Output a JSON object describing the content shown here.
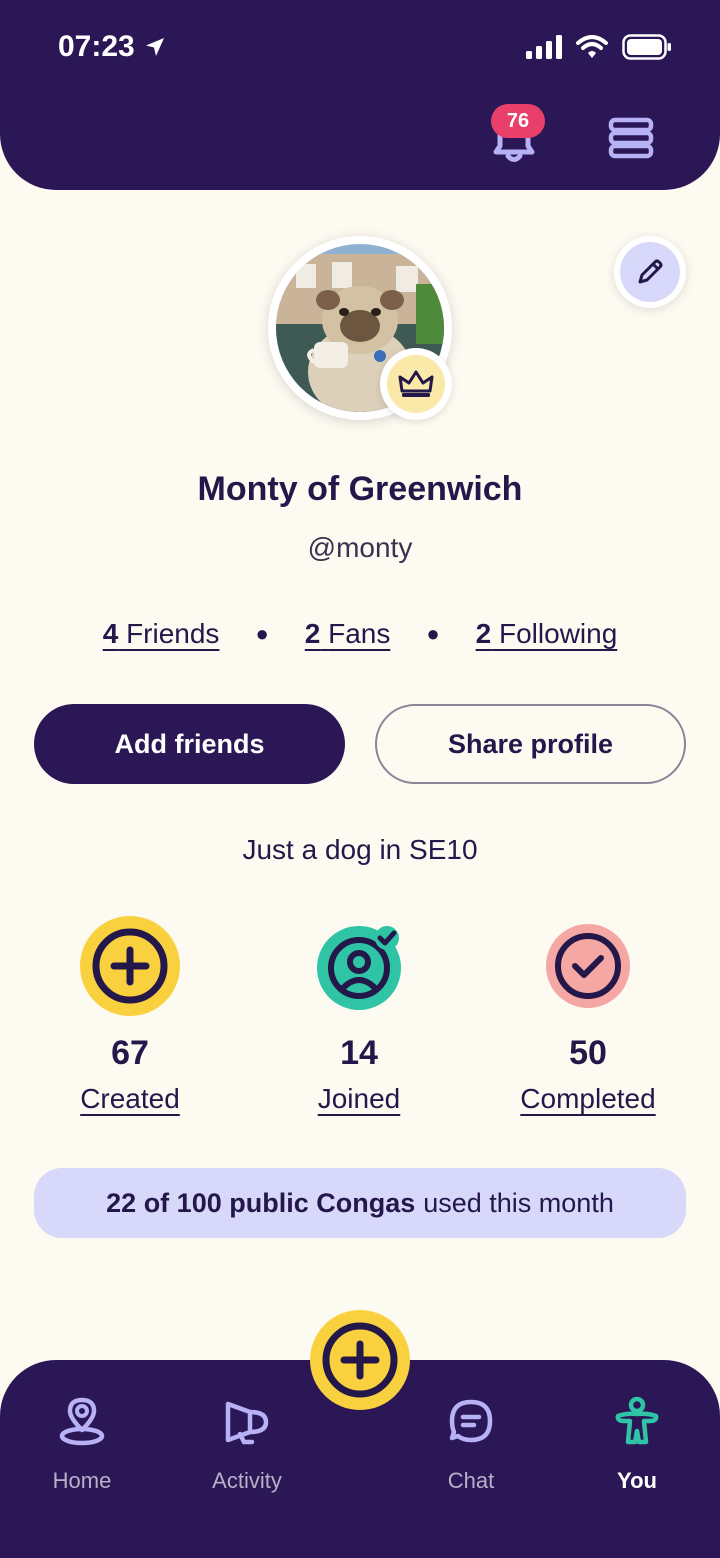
{
  "status_bar": {
    "time": "07:23"
  },
  "header": {
    "notification_count": "76"
  },
  "profile": {
    "name": "Monty of Greenwich",
    "handle": "@monty",
    "social": [
      {
        "count": "4",
        "label": "Friends"
      },
      {
        "count": "2",
        "label": "Fans"
      },
      {
        "count": "2",
        "label": "Following"
      }
    ],
    "bio": "Just a dog in SE10"
  },
  "actions": {
    "add_friends": "Add friends",
    "share_profile": "Share profile"
  },
  "stats": [
    {
      "value": "67",
      "label": "Created",
      "icon": "plus-circle-icon",
      "color": "#f9d13e"
    },
    {
      "value": "14",
      "label": "Joined",
      "icon": "user-check-icon",
      "color": "#2ec4a5"
    },
    {
      "value": "50",
      "label": "Completed",
      "icon": "check-circle-icon",
      "color": "#f4a7a3"
    }
  ],
  "quota": {
    "bold": "22 of 100 public Congas",
    "rest": "used this month"
  },
  "tabs": [
    {
      "label": "Home",
      "icon": "map-pin-icon"
    },
    {
      "label": "Activity",
      "icon": "megaphone-icon"
    },
    {
      "label": "Chat",
      "icon": "chat-bubble-icon"
    },
    {
      "label": "You",
      "icon": "person-icon",
      "active": true
    }
  ],
  "colors": {
    "primary": "#2b1755",
    "accent_yellow": "#f9d13e",
    "badge_red": "#e8406b",
    "lavender": "#d8d8fb",
    "teal": "#2ec4a5",
    "background": "#fdfaf1"
  }
}
